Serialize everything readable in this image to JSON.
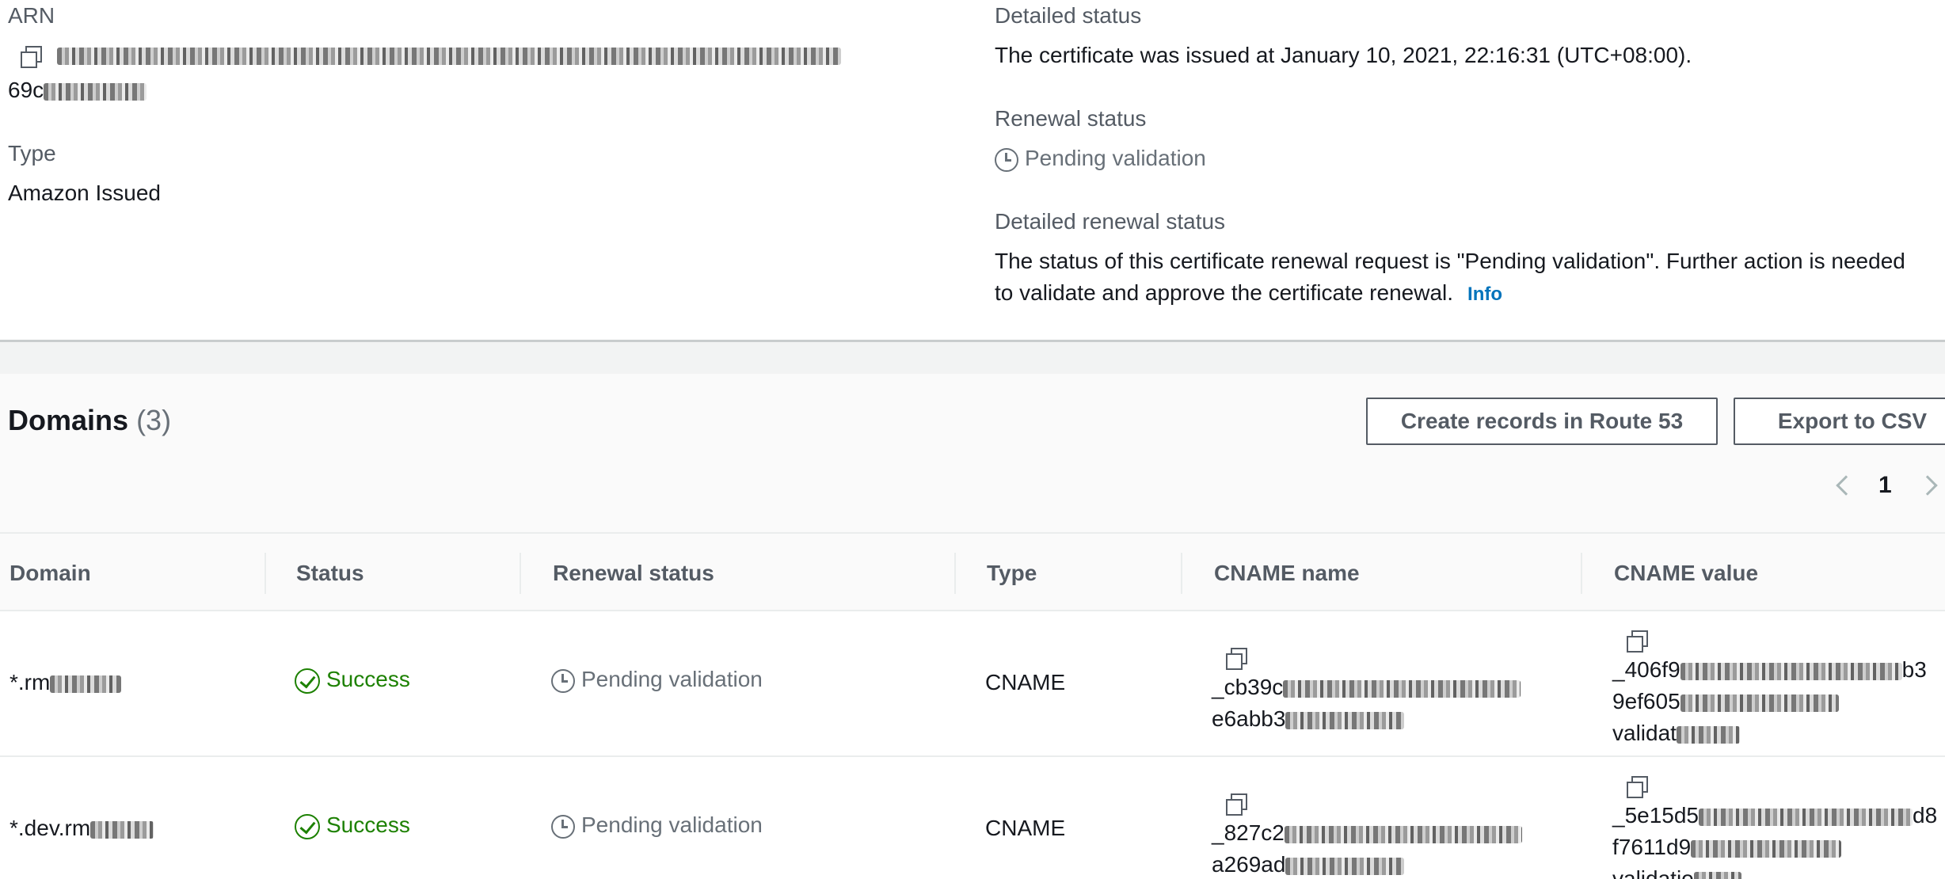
{
  "summary": {
    "arn_label": "ARN",
    "arn_value_suffix": "69c",
    "type_label": "Type",
    "type_value": "Amazon Issued",
    "detailed_status_label": "Detailed status",
    "detailed_status_value": "The certificate was issued at January 10, 2021, 22:16:31 (UTC+08:00).",
    "renewal_status_label": "Renewal status",
    "renewal_status_value": "Pending validation",
    "detailed_renewal_label": "Detailed renewal status",
    "detailed_renewal_line1": "The status of this certificate renewal request is \"Pending validation\". Further action is needed",
    "detailed_renewal_line2": "to validate and approve the certificate renewal.",
    "info_link": "Info"
  },
  "domains": {
    "title": "Domains",
    "count": "(3)",
    "create_records_button": "Create records in Route 53",
    "export_button": "Export to CSV",
    "page_number": "1",
    "columns": [
      "Domain",
      "Status",
      "Renewal status",
      "Type",
      "CNAME name",
      "CNAME value"
    ],
    "rows": [
      {
        "domain": "*.rm",
        "status": "Success",
        "renewal": "Pending validation",
        "type": "CNAME",
        "cname_name_l1": "_cb39c",
        "cname_name_l2": "e6abb3",
        "cname_value_l1": "_406f9",
        "cname_value_l1_end": "b3",
        "cname_value_l2": "9ef605",
        "cname_value_l3": "validat"
      },
      {
        "domain": "*.dev.rm",
        "status": "Success",
        "renewal": "Pending validation",
        "type": "CNAME",
        "cname_name_l1": "_827c2",
        "cname_name_l2": "a269ad",
        "cname_value_l1": "_5e15d5",
        "cname_value_l1_end": "d8",
        "cname_value_l2": "f7611d9",
        "cname_value_l3": "validatio"
      }
    ]
  },
  "colors": {
    "success": "#1d8102",
    "pending": "#687078",
    "link": "#0073bb"
  }
}
